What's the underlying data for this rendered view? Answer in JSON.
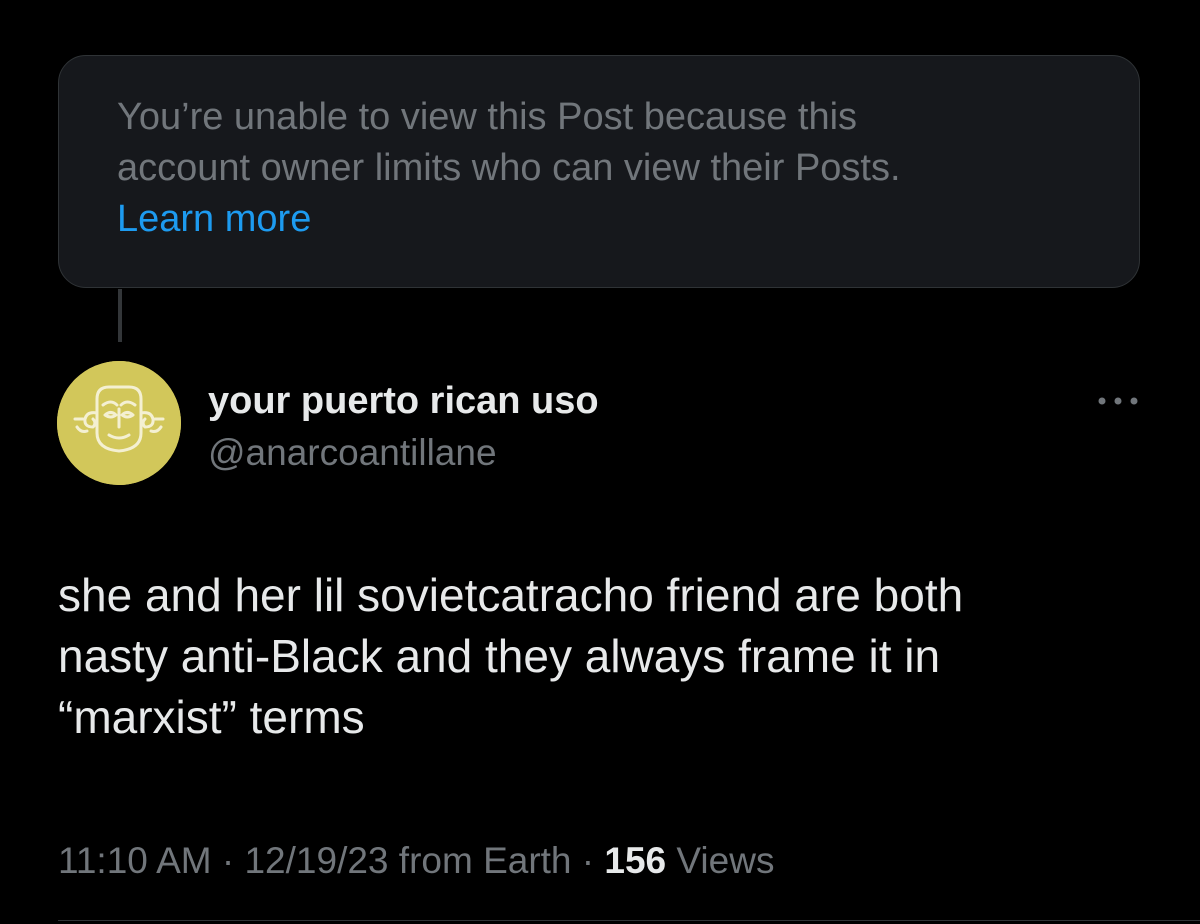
{
  "notice": {
    "line1": "You’re unable to view this Post because this",
    "line2": "account owner limits who can view their Posts.",
    "link_label": "Learn more"
  },
  "author": {
    "display_name": "your puerto rican uso",
    "handle": "@anarcoantillane",
    "avatar_icon": "taino-face-icon"
  },
  "more_icon": "ellipsis-icon",
  "post": {
    "lines": [
      "she and her lil sovietcatracho friend are both",
      "nasty anti-Black and they always frame it in",
      "“marxist” terms"
    ]
  },
  "meta": {
    "time": "11:10 AM",
    "separator": " · ",
    "date_location": "12/19/23 from Earth",
    "views_count": "156",
    "views_label": " Views"
  },
  "colors": {
    "background": "#000000",
    "text_primary": "#e7e9ea",
    "text_secondary": "#71767b",
    "link": "#1d9bf0",
    "avatar_bg": "#d2c75a"
  }
}
